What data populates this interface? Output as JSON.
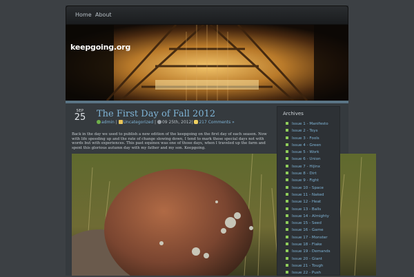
{
  "nav": {
    "items": [
      "Home",
      "About"
    ]
  },
  "header": {
    "logo_text": "keepgoing.org"
  },
  "post": {
    "date_month": "SEP",
    "date_day": "25",
    "title": "The First Day of Fall 2012",
    "meta": {
      "author": "admin",
      "category": "Uncategorized",
      "date": "09 25th, 2012",
      "comments": "217 Comments »"
    },
    "body": "Back in the day we used to publish a new edition of the keepgoing on the first day of each season. Now with life speeding up and the rate of change slowing down, I tend to mark these special days not with words but with experiences. This past equinox was one of those days, when I traveled up the farm and spent this glorious autumn day with my father and my son. Keepgoing."
  },
  "sidebar": {
    "title": "Archives",
    "items": [
      "Issue 1 - Manifesto",
      "Issue 2 - Toys",
      "Issue 3 - Fools",
      "Issue 4 - Green",
      "Issue 5 - Work",
      "Issue 6 - Union",
      "Issue 7 - Hijinx",
      "Issue 8 - Dirt",
      "Issue 9 - Fight",
      "Issue 10 - Space",
      "Issue 11 - Naked",
      "Issue 12 - Heat",
      "Issue 13 - Balls",
      "Issue 14 - Almighty",
      "Issue 15 - Seed",
      "Issue 16 - Game",
      "Issue 17 - Monster",
      "Issue 18 - Flake",
      "Issue 19 - Demands",
      "Issue 20 - Giant",
      "Issue 21 - Tough",
      "Issue 22 - Push"
    ]
  },
  "colors": {
    "link": "#7fb4d6",
    "bullet": "#8fce5a",
    "background": "#3c4044"
  }
}
